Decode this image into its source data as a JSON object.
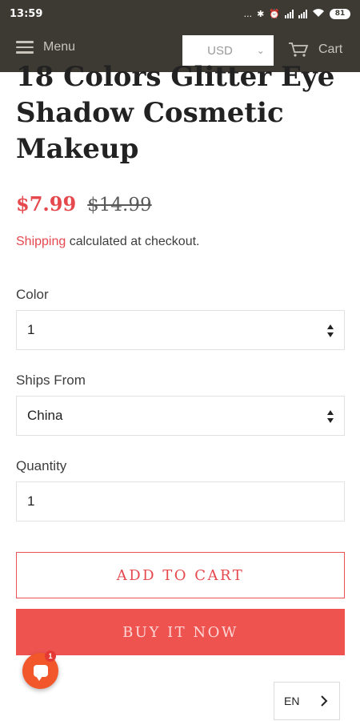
{
  "status_bar": {
    "time": "13:59",
    "icons_text": "...",
    "battery": "81"
  },
  "header": {
    "menu_label": "Menu",
    "currency": "USD",
    "cart_label": "Cart"
  },
  "product": {
    "title": "18 Colors Glitter Eye Shadow Cosmetic Makeup",
    "price": "$7.99",
    "compare_price": "$14.99",
    "shipping_link": "Shipping",
    "shipping_rest": " calculated at checkout."
  },
  "options": {
    "color_label": "Color",
    "color_value": "1",
    "ships_from_label": "Ships From",
    "ships_from_value": "China",
    "quantity_label": "Quantity",
    "quantity_value": "1"
  },
  "buttons": {
    "add_to_cart": "ADD TO CART",
    "buy_it_now": "BUY IT NOW"
  },
  "chat": {
    "badge_count": "1"
  },
  "language": {
    "code": "EN"
  },
  "colors": {
    "header_bg": "#3d3a33",
    "accent": "#ef5350",
    "price": "#e5484d"
  }
}
